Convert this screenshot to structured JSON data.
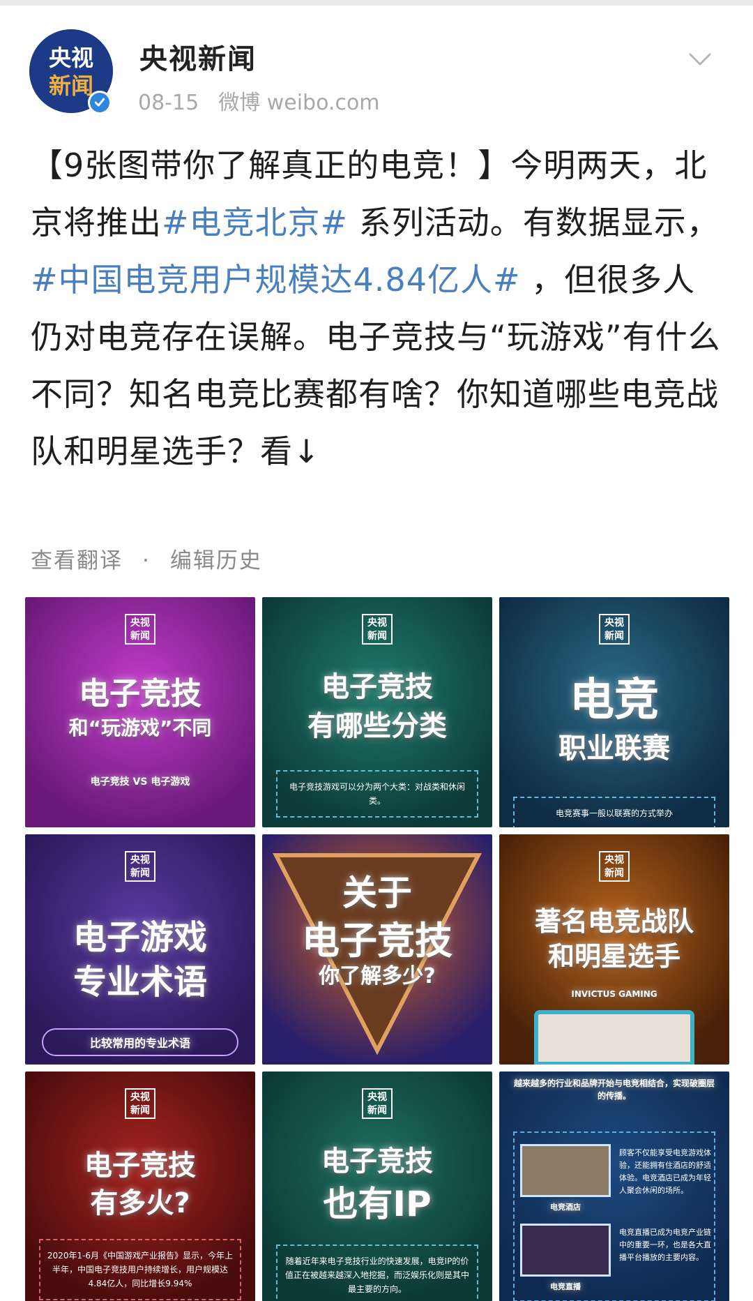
{
  "post": {
    "author": "央视新闻",
    "avatar_text_line1": "央视",
    "avatar_text_line2": "新闻",
    "date": "08-15",
    "source": "微博 weibo.com",
    "body_parts": [
      {
        "text": "【9张图带你了解真正的电竞！】今明两天，北京将推出",
        "tag": false
      },
      {
        "text": "#电竞北京#",
        "tag": true
      },
      {
        "text": " 系列活动。有数据显示，",
        "tag": false
      },
      {
        "text": "#中国电竞用户规模达4.84亿人#",
        "tag": true
      },
      {
        "text": " ，但很多人仍对电竞存在误解。电子竞技与“玩游戏”有什么不同？知名电竞比赛都有啥？你知道哪些电竞战队和明星选手？看↓",
        "tag": false
      }
    ],
    "translate_label": "查看翻译",
    "separator": "·",
    "history_label": "编辑历史"
  },
  "images": [
    {
      "badge": "央视新闻",
      "title": "电子竞技",
      "subtitle": "和“玩游戏”不同",
      "extra": "电子竞技 VS 电子游戏",
      "bg1": "#6a1a7a",
      "bg2": "#c23cc9"
    },
    {
      "badge": "央视新闻",
      "title": "电子竞技",
      "subtitle": "有哪些分类",
      "extra": "电子竞技游戏可以分为两个大类：对战类和休闲类。",
      "bg1": "#0d3b3a",
      "bg2": "#1f7a6b"
    },
    {
      "badge": "央视新闻",
      "title": "电竞",
      "subtitle": "职业联赛",
      "extra": "电竞赛事一般以联赛的方式举办",
      "bg1": "#0f2c45",
      "bg2": "#2a6a86"
    },
    {
      "badge": "央视新闻",
      "title": "电子游戏",
      "subtitle": "专业术语",
      "extra": "比较常用的专业术语",
      "bg1": "#2a1a5a",
      "bg2": "#5a3aa0"
    },
    {
      "badge": "",
      "title": "关于",
      "subtitle": "电子竞技",
      "extra": "你了解多少?",
      "bg1": "#2a1f6a",
      "bg2": "#d06020"
    },
    {
      "badge": "央视新闻",
      "title": "著名电竞战队",
      "subtitle": "和明星选手",
      "extra": "INVICTUS GAMING",
      "bg1": "#4a2208",
      "bg2": "#b4621c"
    },
    {
      "badge": "央视新闻",
      "title": "电子竞技",
      "subtitle": "有多火?",
      "extra": "2020年1-6月《中国游戏产业报告》显示，今年上半年，中国电子竞技用户持续增长，用户规模达4.84亿人，同比增长9.94%",
      "bg1": "#4a0c0c",
      "bg2": "#a42420"
    },
    {
      "badge": "央视新闻",
      "title": "电子竞技",
      "subtitle": "也有IP",
      "extra": "随着近年来电子竞技行业的快速发展，电竞IP的价值正在被越来越深入地挖掘，而泛娱乐化则是其中最主要的方向。",
      "bg1": "#0c3a36",
      "bg2": "#1f6e5e"
    },
    {
      "badge": "",
      "title": "",
      "subtitle": "",
      "extra": "越来越多的行业和品牌开始与电竞相结合，实现破圈层的传播。",
      "caption1": "电竞酒店",
      "caption2": "电竞直播",
      "note1": "顾客不仅能享受电竞游戏体验，还能拥有住酒店的舒适体验。电竞酒店已成为年轻人聚会休闲的场所。",
      "note2": "电竞直播已成为电竞产业链中的重要一环，也是各大直播平台播放的主要内容。",
      "bg1": "#0f2a50",
      "bg2": "#1d4a80"
    }
  ],
  "colors": {
    "tag_link": "#4a7fbf",
    "meta_gray": "#a8a8a8",
    "avatar_blue": "#1c3a86",
    "verified_blue": "#2e86de"
  }
}
